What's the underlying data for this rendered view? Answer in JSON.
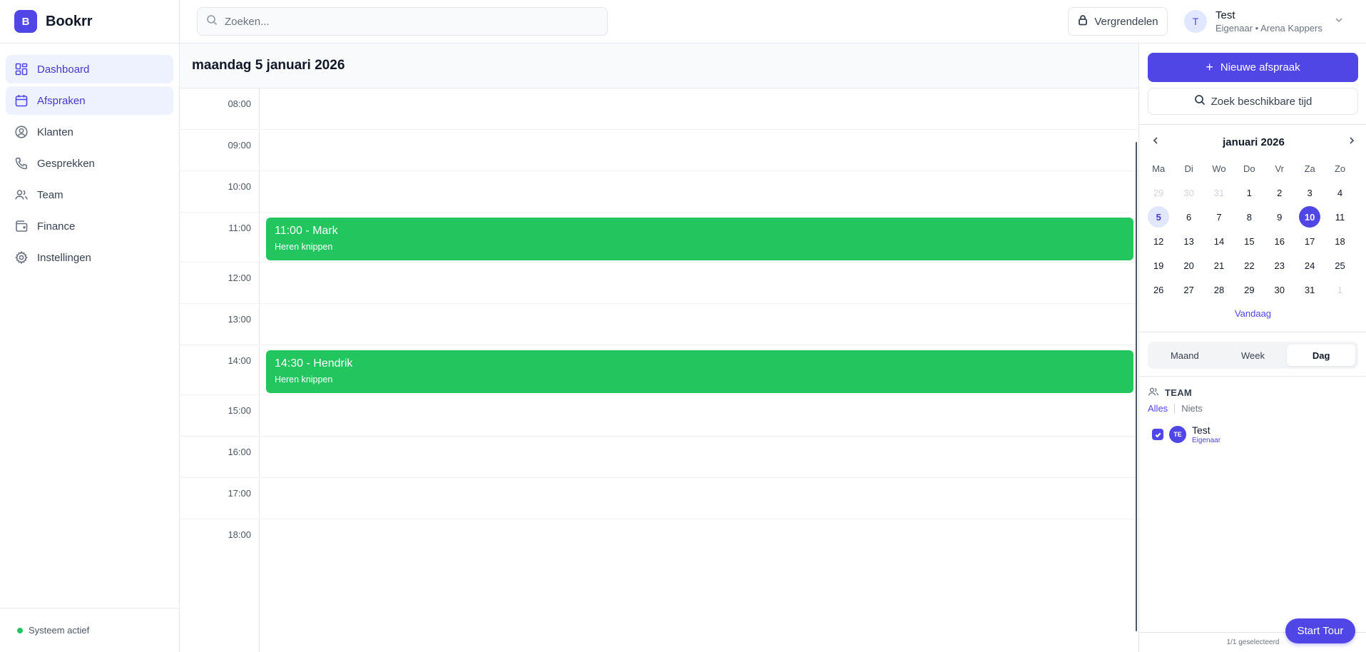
{
  "brand": {
    "logo_letter": "B",
    "name": "Bookrr"
  },
  "sidebar": {
    "items": [
      {
        "label": "Dashboard",
        "icon": "grid-icon",
        "active": true
      },
      {
        "label": "Afspraken",
        "icon": "calendar-icon",
        "active": true
      },
      {
        "label": "Klanten",
        "icon": "user-circle-icon",
        "active": false
      },
      {
        "label": "Gesprekken",
        "icon": "phone-icon",
        "active": false
      },
      {
        "label": "Team",
        "icon": "users-icon",
        "active": false
      },
      {
        "label": "Finance",
        "icon": "wallet-icon",
        "active": false
      },
      {
        "label": "Instellingen",
        "icon": "gear-icon",
        "active": false
      }
    ],
    "status": "Systeem actief"
  },
  "topbar": {
    "search_placeholder": "Zoeken...",
    "lock_label": "Vergrendelen",
    "user": {
      "initial": "T",
      "name": "Test",
      "role": "Eigenaar • Arena Kappers"
    }
  },
  "main": {
    "date_title": "maandag 5 januari 2026",
    "hours": [
      "08:00",
      "09:00",
      "10:00",
      "11:00",
      "12:00",
      "13:00",
      "14:00",
      "15:00",
      "16:00",
      "17:00",
      "18:00"
    ],
    "appointments": [
      {
        "title": "11:00 - Mark",
        "service": "Heren knippen",
        "color": "#22c55e"
      },
      {
        "title": "14:30 - Hendrik",
        "service": "Heren knippen",
        "color": "#22c55e"
      }
    ]
  },
  "right_panel": {
    "new_button": "Nieuwe afspraak",
    "find_button": "Zoek beschikbare tijd",
    "calendar": {
      "month": "januari 2026",
      "weekdays": [
        "Ma",
        "Di",
        "Wo",
        "Do",
        "Vr",
        "Za",
        "Zo"
      ],
      "weeks": [
        [
          "29",
          "30",
          "31",
          "1",
          "2",
          "3",
          "4"
        ],
        [
          "5",
          "6",
          "7",
          "8",
          "9",
          "10",
          "11"
        ],
        [
          "12",
          "13",
          "14",
          "15",
          "16",
          "17",
          "18"
        ],
        [
          "19",
          "20",
          "21",
          "22",
          "23",
          "24",
          "25"
        ],
        [
          "26",
          "27",
          "28",
          "29",
          "30",
          "31",
          "1"
        ]
      ],
      "selected_day": "5",
      "today_day": "10",
      "today_link": "Vandaag"
    },
    "views": [
      "Maand",
      "Week",
      "Dag"
    ],
    "active_view": "Dag",
    "team": {
      "heading": "TEAM",
      "all_label": "Alles",
      "none_label": "Niets",
      "members": [
        {
          "initials": "TE",
          "name": "Test",
          "role": "Eigenaar",
          "checked": true
        }
      ],
      "selected_count": "1/1 geselecteerd"
    }
  },
  "tour_button": "Start Tour",
  "colors": {
    "accent": "#4f46e5",
    "appointment": "#22c55e",
    "status_active": "#22c55e"
  }
}
